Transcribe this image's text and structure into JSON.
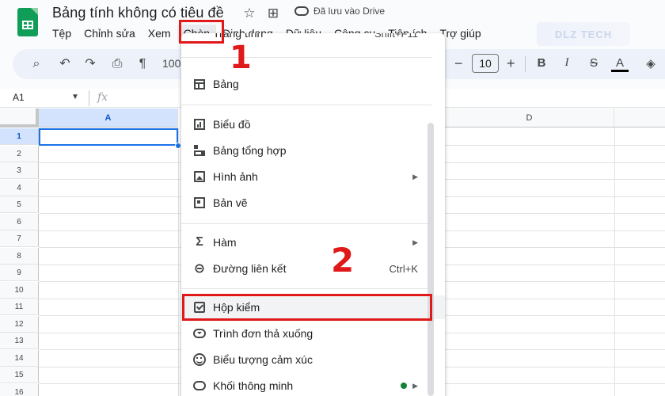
{
  "app": {
    "doc_title": "Bảng tính không có tiêu đề",
    "save_status": "Đã lưu vào Drive",
    "brand_color": "#0f9d58",
    "watermark": "DLZ TECH"
  },
  "menubar": {
    "items": [
      "Tệp",
      "Chỉnh sửa",
      "Xem",
      "Chèn",
      "Định dạng",
      "Dữ liệu",
      "Công cụ",
      "Tiện ích",
      "Trợ giúp"
    ],
    "active": "Chèn"
  },
  "toolbar": {
    "zoom": "100",
    "font_size": "10",
    "minus": "−",
    "plus": "+",
    "bold": "B",
    "italic": "I",
    "strike": "S",
    "text_color": "A",
    "icons": [
      "search-icon",
      "undo-icon",
      "redo-icon",
      "print-icon",
      "paint-format-icon",
      "fill-color-icon"
    ]
  },
  "formula_bar": {
    "cell_ref": "A1",
    "fx": "fx"
  },
  "grid": {
    "columns": [
      "A",
      "D"
    ],
    "rows": [
      "1",
      "2",
      "3",
      "4",
      "5",
      "6",
      "7",
      "8",
      "9",
      "10",
      "11",
      "12",
      "13",
      "14",
      "15",
      "16"
    ],
    "selected_cell": "A1"
  },
  "insert_menu": {
    "partial_item": "Trang tính",
    "partial_shortcut": "Shift+F11",
    "items": [
      {
        "label": "Bảng",
        "icon": "table-icon"
      },
      {
        "label": "Biểu đồ",
        "icon": "chart-icon"
      },
      {
        "label": "Bảng tổng hợp",
        "icon": "pivot-table-icon"
      },
      {
        "label": "Hình ảnh",
        "icon": "image-icon",
        "submenu": true
      },
      {
        "label": "Bản vẽ",
        "icon": "drawing-icon"
      },
      {
        "label": "Hàm",
        "icon": "sigma-icon",
        "submenu": true
      },
      {
        "label": "Đường liên kết",
        "icon": "link-icon",
        "shortcut": "Ctrl+K"
      },
      {
        "label": "Hộp kiểm",
        "icon": "checkbox-icon",
        "highlighted": true
      },
      {
        "label": "Trình đơn thả xuống",
        "icon": "dropdown-icon"
      },
      {
        "label": "Biểu tượng cảm xúc",
        "icon": "emoji-icon"
      },
      {
        "label": "Khối thông minh",
        "icon": "smart-chips-icon",
        "submenu": true,
        "new_dot": true
      }
    ]
  },
  "annotations": {
    "step1": "1",
    "step2": "2",
    "color": "#e01919"
  }
}
